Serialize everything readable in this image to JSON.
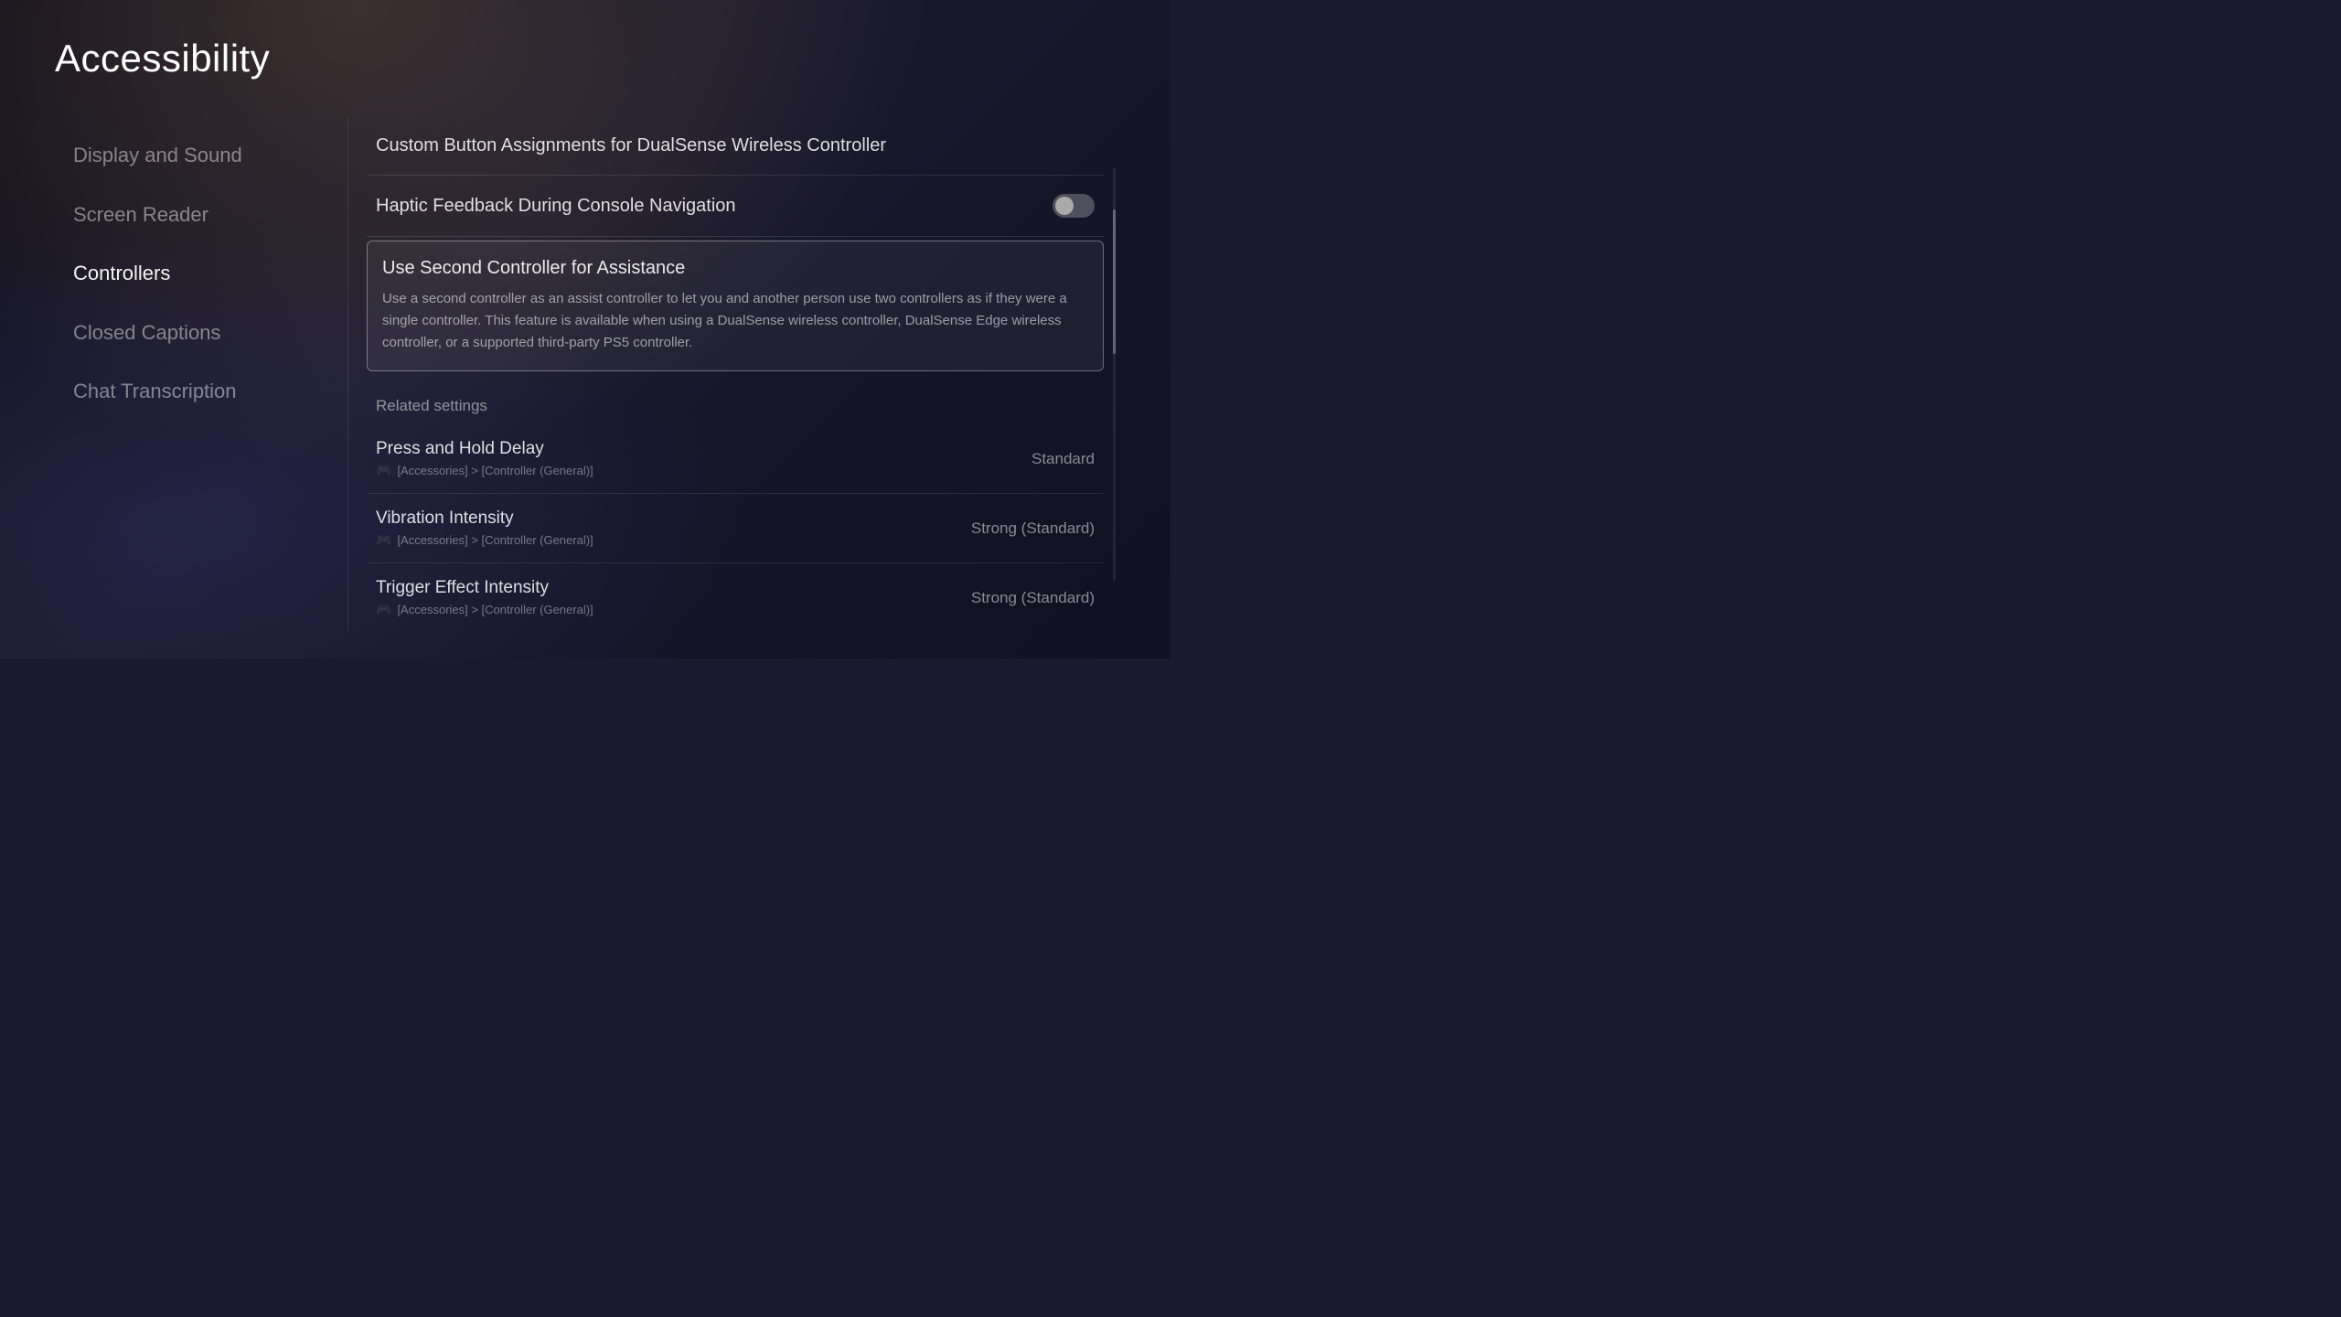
{
  "page": {
    "title": "Accessibility"
  },
  "sidebar": {
    "items": [
      {
        "id": "display-and-sound",
        "label": "Display and Sound",
        "active": false
      },
      {
        "id": "screen-reader",
        "label": "Screen Reader",
        "active": false
      },
      {
        "id": "controllers",
        "label": "Controllers",
        "active": true
      },
      {
        "id": "closed-captions",
        "label": "Closed Captions",
        "active": false
      },
      {
        "id": "chat-transcription",
        "label": "Chat Transcription",
        "active": false
      }
    ]
  },
  "main": {
    "settings": [
      {
        "id": "custom-button-assignments",
        "label": "Custom Button Assignments for DualSense Wireless Controller",
        "type": "link"
      },
      {
        "id": "haptic-feedback",
        "label": "Haptic Feedback During Console Navigation",
        "type": "toggle",
        "value": false
      }
    ],
    "selected_setting": {
      "id": "use-second-controller",
      "title": "Use Second Controller for Assistance",
      "description": "Use a second controller as an assist controller to let you and another person use two controllers as if they were a single controller. This feature is available when using a DualSense wireless controller, DualSense Edge wireless controller, or a supported third-party PS5 controller."
    },
    "related_settings_header": "Related settings",
    "related_settings": [
      {
        "id": "press-and-hold-delay",
        "title": "Press and Hold Delay",
        "path": "[Accessories] > [Controller (General)]",
        "value": "Standard"
      },
      {
        "id": "vibration-intensity",
        "title": "Vibration Intensity",
        "path": "[Accessories] > [Controller (General)]",
        "value": "Strong (Standard)"
      },
      {
        "id": "trigger-effect-intensity",
        "title": "Trigger Effect Intensity",
        "path": "[Accessories] > [Controller (General)]",
        "value": "Strong (Standard)"
      }
    ]
  }
}
